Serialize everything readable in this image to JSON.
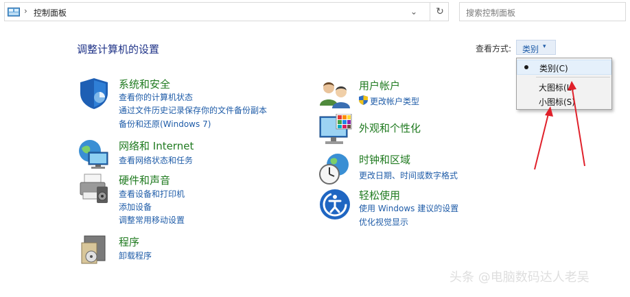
{
  "address_bar": {
    "location": "控制面板",
    "separator": "›",
    "dropdown_glyph": "⌄",
    "refresh_glyph": "↻"
  },
  "search": {
    "placeholder": "搜索控制面板"
  },
  "page": {
    "title": "调整计算机的设置"
  },
  "view_by": {
    "label": "查看方式:",
    "value": "类别",
    "caret": "▾"
  },
  "view_menu": {
    "items": [
      {
        "label": "类别(C)",
        "selected": true
      },
      {
        "label": "大图标(L)",
        "selected": false
      },
      {
        "label": "小图标(S)",
        "selected": false
      }
    ]
  },
  "categories": {
    "system_security": {
      "title": "系统和安全",
      "links": [
        "查看你的计算机状态",
        "通过文件历史记录保存你的文件备份副本",
        "备份和还原(Windows 7)"
      ]
    },
    "network": {
      "title": "网络和 Internet",
      "links": [
        "查看网络状态和任务"
      ]
    },
    "hardware": {
      "title": "硬件和声音",
      "links": [
        "查看设备和打印机",
        "添加设备",
        "调整常用移动设置"
      ]
    },
    "programs": {
      "title": "程序",
      "links": [
        "卸载程序"
      ]
    },
    "user_accounts": {
      "title": "用户帐户",
      "links": [
        "更改帐户类型"
      ]
    },
    "appearance": {
      "title": "外观和个性化",
      "links": []
    },
    "clock_region": {
      "title": "时钟和区域",
      "links": [
        "更改日期、时间或数字格式"
      ]
    },
    "ease_access": {
      "title": "轻松使用",
      "links": [
        "使用 Windows 建议的设置",
        "优化视觉显示"
      ]
    }
  },
  "watermark": {
    "text": "头条 @电脑数码达人老吴"
  },
  "colors": {
    "link": "#1f5ca8",
    "category_title": "#1f7a1f",
    "page_title": "#1e3287",
    "annotation_arrow": "#e0202a"
  },
  "icons": {
    "address": "control-panel-icon",
    "search": "none",
    "system_security": "shield-icon",
    "network": "globe-network-icon",
    "hardware": "printer-icon",
    "programs": "programs-box-icon",
    "user_accounts": "users-icon",
    "appearance": "monitor-color-icon",
    "clock_region": "clock-globe-icon",
    "ease_access": "ease-of-access-icon"
  }
}
